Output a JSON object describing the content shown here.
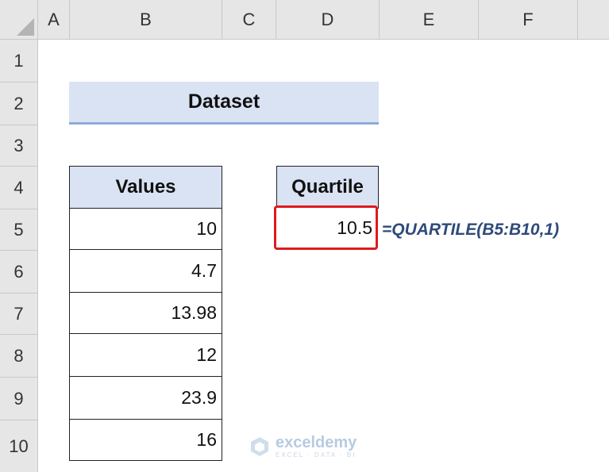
{
  "spreadsheet": {
    "columns": [
      "A",
      "B",
      "C",
      "D",
      "E",
      "F"
    ],
    "rows": [
      "1",
      "2",
      "3",
      "4",
      "5",
      "6",
      "7",
      "8",
      "9",
      "10"
    ]
  },
  "dataset_title": "Dataset",
  "values_table": {
    "header": "Values",
    "values": [
      "10",
      "4.7",
      "13.98",
      "12",
      "23.9",
      "16"
    ]
  },
  "quartile": {
    "header": "Quartile",
    "result": "10.5",
    "formula": "=QUARTILE(B5:B10,1)"
  },
  "watermark": {
    "name": "exceldemy",
    "tagline": "EXCEL · DATA · BI"
  },
  "colors": {
    "header_fill": "#dae3f3",
    "accent_border": "#8eaadb",
    "highlight_red": "#e0191e",
    "formula_text": "#2e4a7a"
  }
}
